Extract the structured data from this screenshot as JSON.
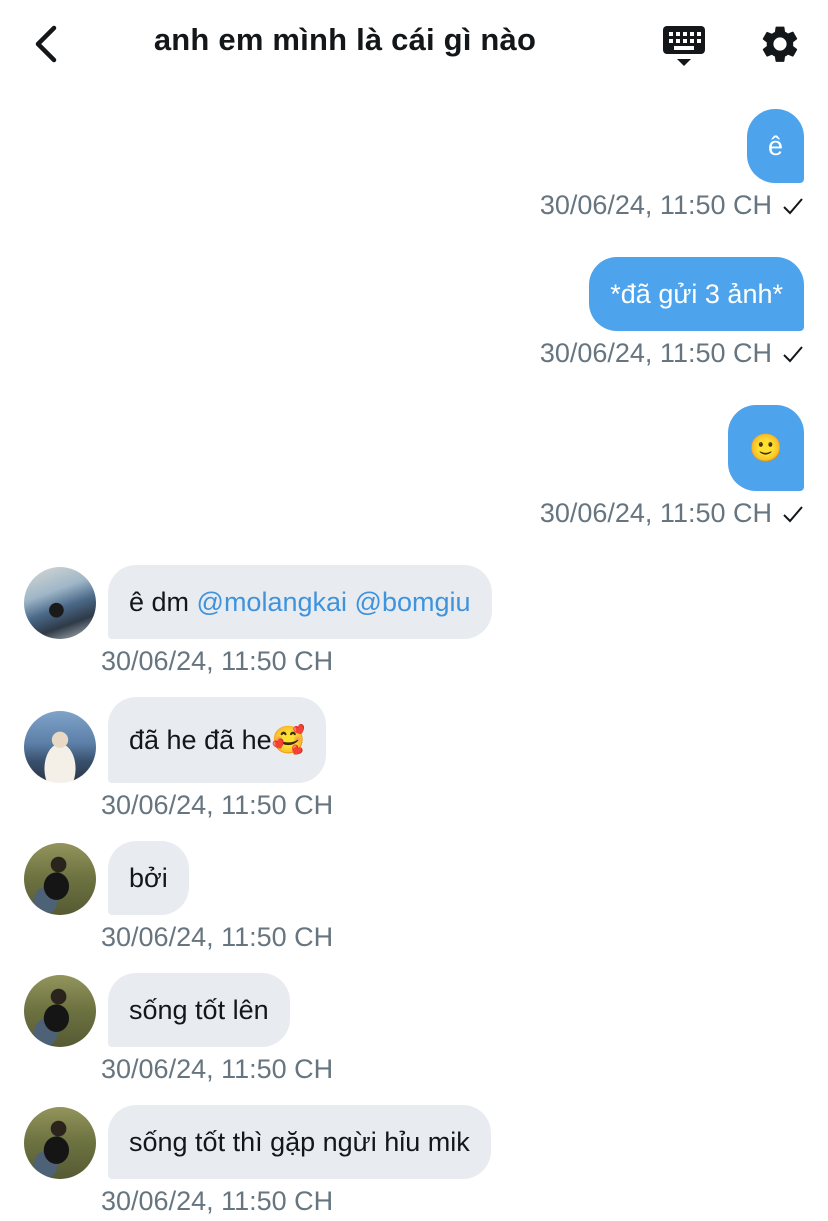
{
  "header": {
    "title": "anh em mình là cái gì nào",
    "icons": {
      "back": "chevron-left-icon",
      "keyboard": "keyboard-icon",
      "settings": "gear-icon"
    }
  },
  "colors": {
    "outgoing_bubble": "#4da3ec",
    "incoming_bubble": "#e8ecf0",
    "mention": "#3f93dd",
    "timestamp": "#66757f"
  },
  "messages": [
    {
      "direction": "out",
      "text": "ê",
      "timestamp": "30/06/24, 11:50 CH",
      "status": "sent-check"
    },
    {
      "direction": "out",
      "text": "*đã gửi 3 ảnh*",
      "timestamp": "30/06/24, 11:50 CH",
      "status": "sent-check"
    },
    {
      "direction": "out",
      "text": "🙂",
      "timestamp": "30/06/24, 11:50 CH",
      "status": "sent-check"
    },
    {
      "direction": "in",
      "text_prefix": "ê dm ",
      "mentions": [
        "@molangkai",
        "@bomgiu"
      ],
      "timestamp": "30/06/24, 11:50 CH"
    },
    {
      "direction": "in",
      "text": "đã he đã he🥰",
      "timestamp": "30/06/24, 11:50 CH"
    },
    {
      "direction": "in",
      "text": "bởi",
      "timestamp": "30/06/24, 11:50 CH"
    },
    {
      "direction": "in",
      "text": "sống tốt lên",
      "timestamp": "30/06/24, 11:50 CH"
    },
    {
      "direction": "in",
      "text": "sống tốt thì gặp ngừi hỉu mik",
      "timestamp": "30/06/24, 11:50 CH"
    }
  ]
}
